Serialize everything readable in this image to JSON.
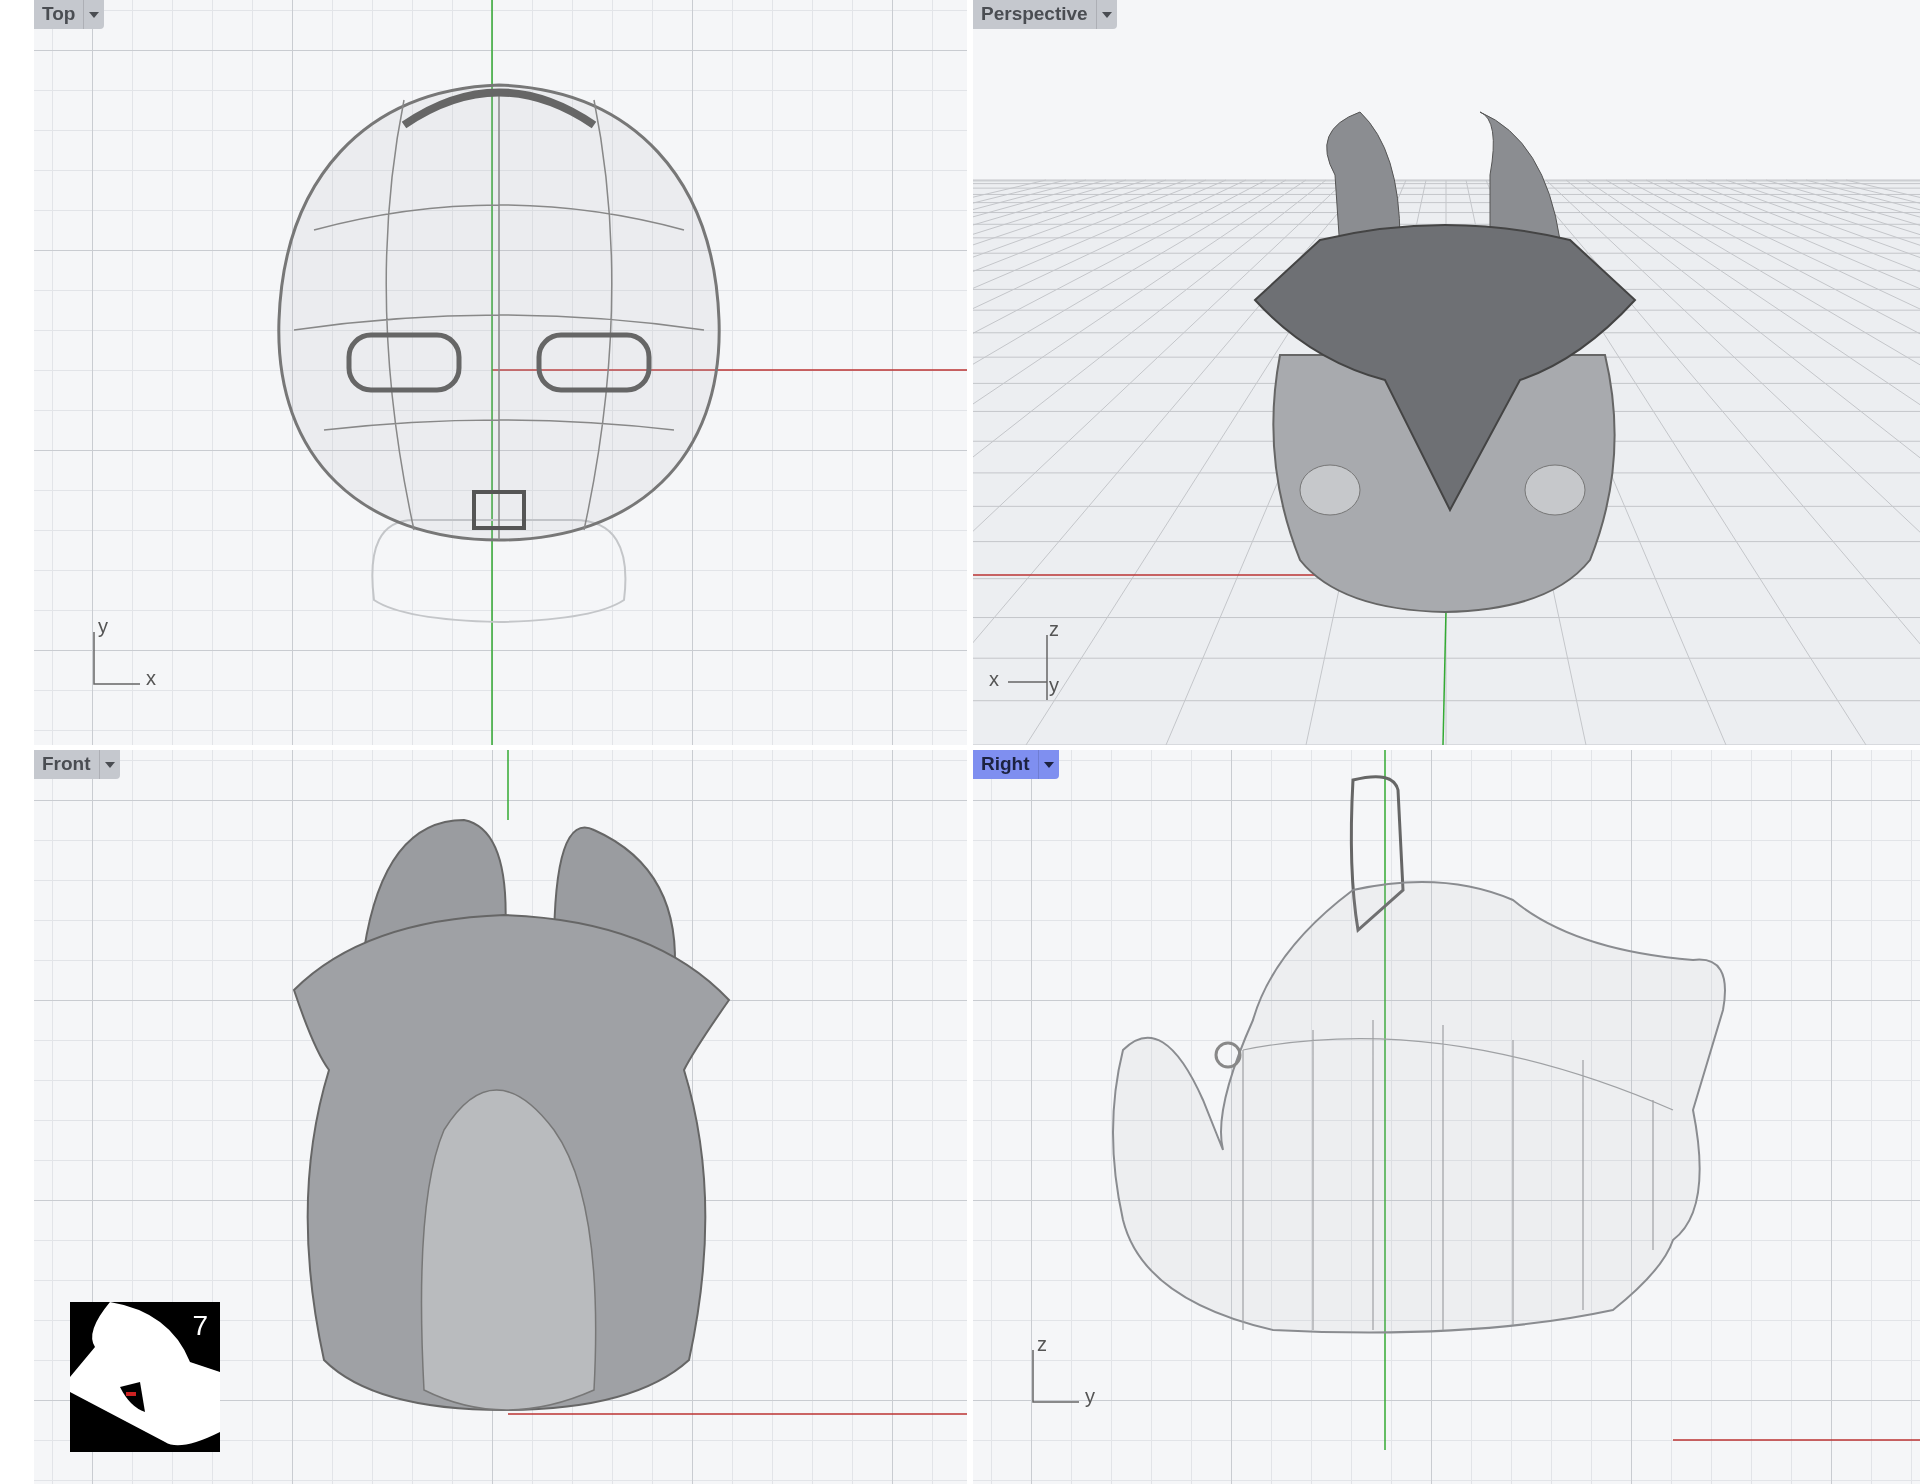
{
  "viewports": [
    {
      "title": "Top",
      "selected": false,
      "kind": "top",
      "axes": {
        "vertical": "y",
        "horizontal": "x"
      }
    },
    {
      "title": "Perspective",
      "selected": false,
      "kind": "perspective",
      "axes": {
        "vertical": "z",
        "horizontal": "x",
        "depth": "y"
      }
    },
    {
      "title": "Front",
      "selected": false,
      "kind": "front",
      "logo": "7"
    },
    {
      "title": "Right",
      "selected": true,
      "kind": "right",
      "axes": {
        "vertical": "z",
        "horizontal": "y"
      }
    }
  ]
}
